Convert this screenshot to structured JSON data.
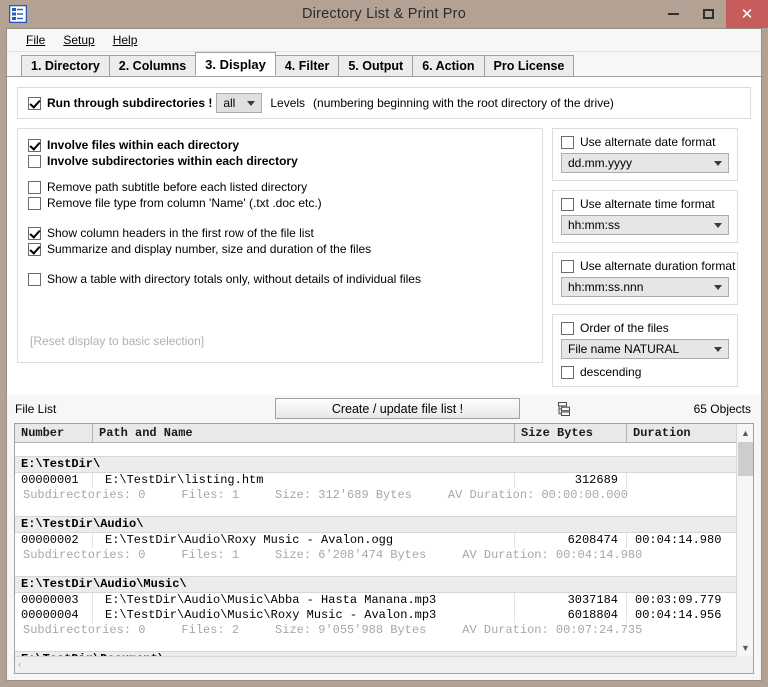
{
  "window": {
    "title": "Directory List & Print Pro",
    "icon": "document-list-icon",
    "minimize_label": "–",
    "maximize_label": "□",
    "close_label": "✕",
    "title_bar_color": "#b3a294",
    "close_button_color": "#c75c5c"
  },
  "menu": {
    "items": [
      {
        "label": "File",
        "accel": "F"
      },
      {
        "label": "Setup",
        "accel": "S"
      },
      {
        "label": "Help",
        "accel": "H"
      }
    ]
  },
  "tabs": [
    {
      "label": "1. Directory",
      "active": false
    },
    {
      "label": "2. Columns",
      "active": false
    },
    {
      "label": "3. Display",
      "active": true
    },
    {
      "label": "4. Filter",
      "active": false
    },
    {
      "label": "5. Output",
      "active": false
    },
    {
      "label": "6. Action",
      "active": false
    },
    {
      "label": "Pro License",
      "active": false
    }
  ],
  "display_tab": {
    "subdirectories": {
      "checkbox_label": "Run through subdirectories !",
      "checked": true,
      "levels_value": "all",
      "levels_label": "Levels",
      "levels_note": "(numbering beginning with the root directory of the drive)"
    },
    "options": [
      {
        "label": "Involve files within each directory",
        "checked": true,
        "bold": true
      },
      {
        "label": "Involve subdirectories within each directory",
        "checked": false,
        "bold": true
      },
      {
        "label": "Remove path subtitle before each listed directory",
        "checked": false,
        "bold": false
      },
      {
        "label": "Remove file type from column 'Name' (.txt .doc etc.)",
        "checked": false,
        "bold": false
      },
      {
        "label": "Show column headers in the first row of the file list",
        "checked": true,
        "bold": false
      },
      {
        "label": "Summarize and display number, size and duration of the files",
        "checked": true,
        "bold": false
      },
      {
        "label": "Show a table with directory totals only, without details of individual files",
        "checked": false,
        "bold": false
      }
    ],
    "reset_link": "[Reset display to basic selection]",
    "format_boxes": [
      {
        "checkbox_label": "Use alternate date format",
        "checked": false,
        "value": "dd.mm.yyyy"
      },
      {
        "checkbox_label": "Use alternate time format",
        "checked": false,
        "value": "hh:mm:ss"
      },
      {
        "checkbox_label": "Use alternate duration format",
        "checked": false,
        "value": "hh:mm:ss.nnn"
      }
    ],
    "order_box": {
      "checkbox_label": "Order of the files",
      "checked": false,
      "value": "File name NATURAL",
      "descending_label": "descending",
      "descending_checked": false
    }
  },
  "file_list": {
    "label": "File List",
    "create_button": "Create / update file list !",
    "tree_icon": "tree-view-icon",
    "objects_count": "65 Objects",
    "columns": [
      "Number",
      "Path and Name",
      "Size Bytes",
      "Duration"
    ],
    "rows": [
      {
        "type": "gap"
      },
      {
        "type": "dirhdr",
        "path": "E:\\TestDir\\"
      },
      {
        "type": "file",
        "number": "00000001",
        "path": "E:\\TestDir\\listing.htm",
        "size": "312689",
        "duration": ""
      },
      {
        "type": "summary",
        "text": "Subdirectories: 0     Files: 1     Size: 312'689 Bytes     AV Duration: 00:00:00.000"
      },
      {
        "type": "gap"
      },
      {
        "type": "dirhdr",
        "path": "E:\\TestDir\\Audio\\"
      },
      {
        "type": "file",
        "number": "00000002",
        "path": "E:\\TestDir\\Audio\\Roxy Music - Avalon.ogg",
        "size": "6208474",
        "duration": "00:04:14.980"
      },
      {
        "type": "summary",
        "text": "Subdirectories: 0     Files: 1     Size: 6'208'474 Bytes     AV Duration: 00:04:14.980"
      },
      {
        "type": "gap"
      },
      {
        "type": "dirhdr",
        "path": "E:\\TestDir\\Audio\\Music\\"
      },
      {
        "type": "file",
        "number": "00000003",
        "path": "E:\\TestDir\\Audio\\Music\\Abba - Hasta Manana.mp3",
        "size": "3037184",
        "duration": "00:03:09.779"
      },
      {
        "type": "file",
        "number": "00000004",
        "path": "E:\\TestDir\\Audio\\Music\\Roxy Music - Avalon.mp3",
        "size": "6018804",
        "duration": "00:04:14.956"
      },
      {
        "type": "summary",
        "text": "Subdirectories: 0     Files: 2     Size: 9'055'988 Bytes     AV Duration: 00:07:24.735"
      },
      {
        "type": "gap"
      },
      {
        "type": "dirhdr",
        "path": "E:\\TestDir\\Document\\"
      }
    ],
    "vscroll_up": "▲",
    "vscroll_down": "▼",
    "hscroll_left": "‹",
    "hscroll_right": "›"
  }
}
